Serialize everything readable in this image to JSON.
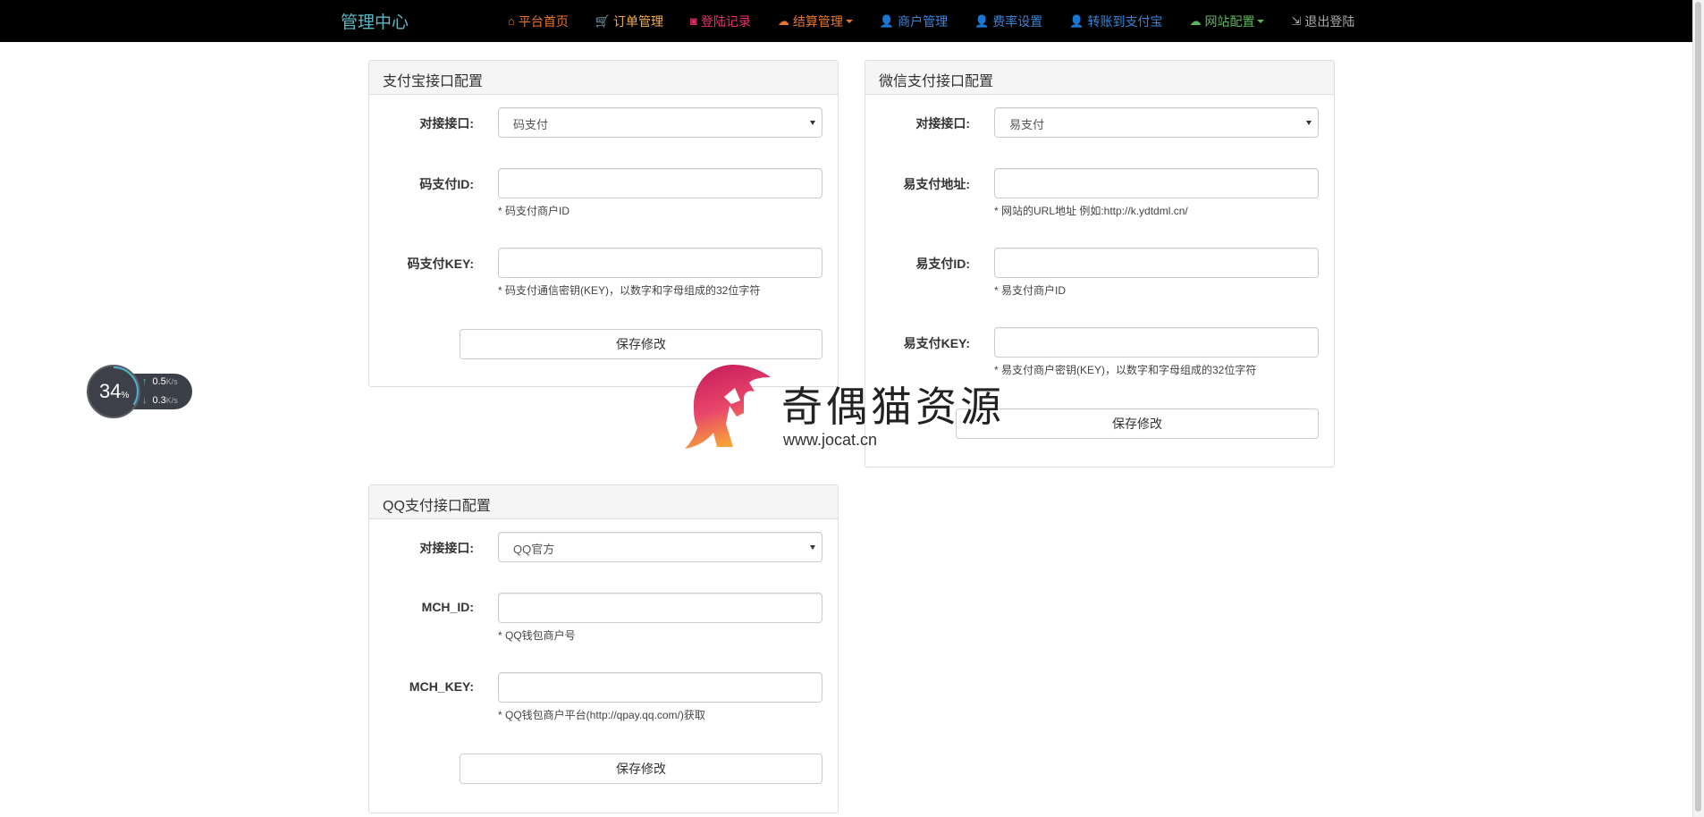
{
  "navbar": {
    "brand": "管理中心",
    "items": [
      {
        "label": "平台首页",
        "color": "#e8762c",
        "icon": "home-icon",
        "glyph": "⌂",
        "dropdown": false
      },
      {
        "label": "订单管理",
        "color": "#f0ad4e",
        "icon": "cart-icon",
        "glyph": "🛒",
        "dropdown": false
      },
      {
        "label": "登陆记录",
        "color": "#e8336b",
        "icon": "camera-icon",
        "glyph": "◙",
        "dropdown": false
      },
      {
        "label": "结算管理",
        "color": "#e8762c",
        "icon": "cloud-icon",
        "glyph": "☁",
        "dropdown": true
      },
      {
        "label": "商户管理",
        "color": "#3a83d8",
        "icon": "user-icon",
        "glyph": "👤",
        "dropdown": false
      },
      {
        "label": "费率设置",
        "color": "#3a83d8",
        "icon": "user-icon",
        "glyph": "👤",
        "dropdown": false
      },
      {
        "label": "转账到支付宝",
        "color": "#3a83d8",
        "icon": "user-icon",
        "glyph": "👤",
        "dropdown": false
      },
      {
        "label": "网站配置",
        "color": "#5cb85c",
        "icon": "cloud-icon",
        "glyph": "☁",
        "dropdown": true
      },
      {
        "label": "退出登陆",
        "color": "#aaaaaa",
        "icon": "logout-icon",
        "glyph": "⇲",
        "dropdown": false
      }
    ]
  },
  "alipay": {
    "title": "支付宝接口配置",
    "interface_label": "对接接口:",
    "interface_value": "码支付",
    "id_label": "码支付ID:",
    "id_help": "* 码支付商户ID",
    "key_label": "码支付KEY:",
    "key_help": "* 码支付通信密钥(KEY)，以数字和字母组成的32位字符",
    "save": "保存修改"
  },
  "wechat": {
    "title": "微信支付接口配置",
    "interface_label": "对接接口:",
    "interface_value": "易支付",
    "url_label": "易支付地址:",
    "url_help": "* 网站的URL地址 例如:http://k.ydtdml.cn/",
    "id_label": "易支付ID:",
    "id_help": "* 易支付商户ID",
    "key_label": "易支付KEY:",
    "key_help": "* 易支付商户密钥(KEY)，以数字和字母组成的32位字符",
    "save": "保存修改"
  },
  "qq": {
    "title": "QQ支付接口配置",
    "interface_label": "对接接口:",
    "interface_value": "QQ官方",
    "mchid_label": "MCH_ID:",
    "mchid_help": "* QQ钱包商户号",
    "mchkey_label": "MCH_KEY:",
    "mchkey_help": "* QQ钱包商户平台(http://qpay.qq.com/)获取",
    "save": "保存修改"
  },
  "speed_widget": {
    "percent": "34",
    "percent_unit": "%",
    "up": "0.5",
    "down": "0.3",
    "unit": "K/s"
  },
  "watermark": {
    "text": "奇偶猫资源",
    "url": "www.jocat.cn"
  }
}
